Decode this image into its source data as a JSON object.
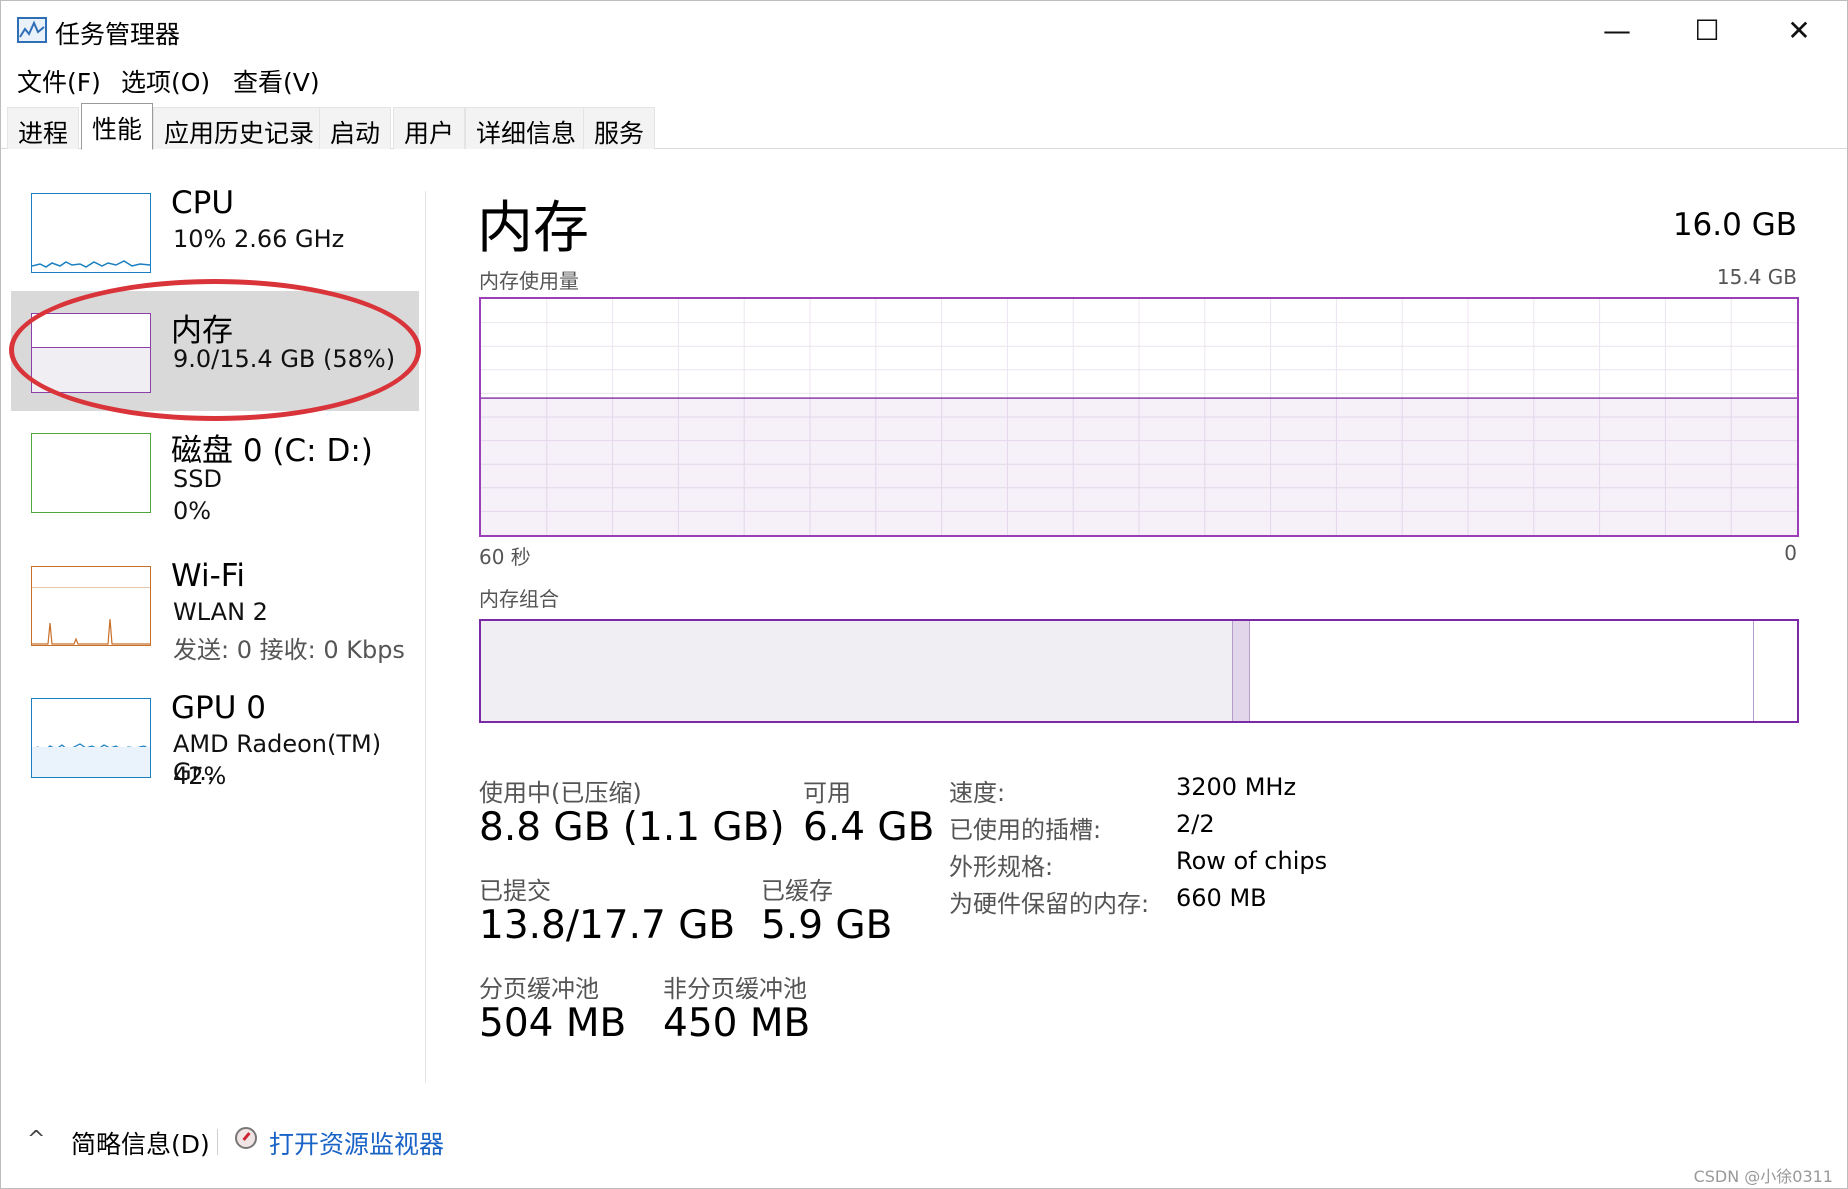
{
  "window": {
    "title": "任务管理器",
    "icon": "task-manager-icon",
    "controls": {
      "minimize": "—",
      "maximize": "☐",
      "close": "✕"
    }
  },
  "menu": [
    "文件(F)",
    "选项(O)",
    "查看(V)"
  ],
  "tabs": [
    {
      "label": "进程",
      "active": false
    },
    {
      "label": "性能",
      "active": true
    },
    {
      "label": "应用历史记录",
      "active": false
    },
    {
      "label": "启动",
      "active": false
    },
    {
      "label": "用户",
      "active": false
    },
    {
      "label": "详细信息",
      "active": false
    },
    {
      "label": "服务",
      "active": false
    }
  ],
  "sidebar": {
    "items": [
      {
        "title": "CPU",
        "lines": [
          "10% 2.66 GHz"
        ],
        "color": "#1a7fc1"
      },
      {
        "title": "内存",
        "lines": [
          "9.0/15.4 GB (58%)"
        ],
        "color": "#8b3fa8",
        "selected": true
      },
      {
        "title": "磁盘 0 (C: D:)",
        "lines": [
          "SSD",
          "0%"
        ],
        "color": "#4fa83d"
      },
      {
        "title": "Wi-Fi",
        "lines": [
          "WLAN 2",
          "发送: 0 接收: 0 Kbps"
        ],
        "color": "#c8702a"
      },
      {
        "title": "GPU 0",
        "lines": [
          "AMD Radeon(TM) Gr..",
          "42%"
        ],
        "color": "#1a7fc1"
      }
    ]
  },
  "main": {
    "title": "内存",
    "total": "16.0 GB",
    "usage_label": "内存使用量",
    "usage_max": "15.4 GB",
    "time_left": "60 秒",
    "time_right": "0",
    "usage_percent": 58,
    "composition_label": "内存组合",
    "composition": {
      "in_use_gb": 8.8,
      "modified_gb": 0.2,
      "standby_gb": 5.9,
      "free_gb": 0.5,
      "total_gb": 15.4
    },
    "stats": {
      "in_use_label": "使用中(已压缩)",
      "in_use_value": "8.8 GB (1.1 GB)",
      "available_label": "可用",
      "available_value": "6.4 GB",
      "committed_label": "已提交",
      "committed_value": "13.8/17.7 GB",
      "cached_label": "已缓存",
      "cached_value": "5.9 GB",
      "paged_label": "分页缓冲池",
      "paged_value": "504 MB",
      "nonpaged_label": "非分页缓冲池",
      "nonpaged_value": "450 MB"
    },
    "details": {
      "speed_label": "速度:",
      "speed_value": "3200 MHz",
      "slots_label": "已使用的插槽:",
      "slots_value": "2/2",
      "form_label": "外形规格:",
      "form_value": "Row of chips",
      "reserved_label": "为硬件保留的内存:",
      "reserved_value": "660 MB"
    }
  },
  "footer": {
    "fewer_details": "简略信息(D)",
    "open_monitor": "打开资源监视器",
    "watermark": "CSDN @小徐0311"
  },
  "colors": {
    "memory": "#8b3fa8",
    "annotation": "#d9343a",
    "link": "#1a63c6"
  }
}
